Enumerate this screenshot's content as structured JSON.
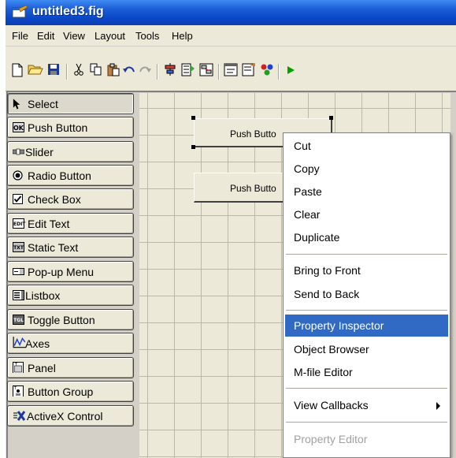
{
  "window": {
    "title": "untitled3.fig"
  },
  "menubar": {
    "items": [
      "File",
      "Edit",
      "View",
      "Layout",
      "Tools",
      "Help"
    ]
  },
  "toolbar": {
    "buttons": [
      "new-icon",
      "open-icon",
      "save-icon",
      "cut-icon",
      "copy-icon",
      "paste-icon",
      "undo-icon",
      "redo-icon",
      "align-icon",
      "menu-editor-icon",
      "tab-order-icon",
      "mfile-editor-icon",
      "property-inspector-icon",
      "object-browser-icon",
      "run-icon"
    ]
  },
  "palette": {
    "items": [
      {
        "label": "Select",
        "icon": "arrow-icon"
      },
      {
        "label": "Push Button",
        "icon": "ok-icon"
      },
      {
        "label": "Slider",
        "icon": "slider-icon"
      },
      {
        "label": "Radio Button",
        "icon": "radio-icon"
      },
      {
        "label": "Check Box",
        "icon": "checkbox-icon"
      },
      {
        "label": "Edit Text",
        "icon": "edit-text-icon",
        "icon_text": "EDIT"
      },
      {
        "label": "Static Text",
        "icon": "static-text-icon",
        "icon_text": "TXT"
      },
      {
        "label": "Pop-up Menu",
        "icon": "popup-menu-icon"
      },
      {
        "label": "Listbox",
        "icon": "listbox-icon"
      },
      {
        "label": "Toggle Button",
        "icon": "toggle-icon",
        "icon_text": "TGL"
      },
      {
        "label": "Axes",
        "icon": "axes-icon"
      },
      {
        "label": "Panel",
        "icon": "panel-icon"
      },
      {
        "label": "Button Group",
        "icon": "button-group-icon"
      },
      {
        "label": "ActiveX Control",
        "icon": "activex-icon"
      }
    ],
    "ok_icon_text": "OK"
  },
  "canvas": {
    "buttons": [
      {
        "label": "Push Butto"
      },
      {
        "label": "Push Butto"
      }
    ]
  },
  "context_menu": {
    "items": [
      {
        "label": "Cut"
      },
      {
        "label": "Copy"
      },
      {
        "label": "Paste"
      },
      {
        "label": "Clear"
      },
      {
        "label": "Duplicate"
      },
      {
        "label": "Bring to Front"
      },
      {
        "label": "Send to Back"
      },
      {
        "label": "Property Inspector",
        "highlighted": true
      },
      {
        "label": "Object Browser"
      },
      {
        "label": "M-file Editor"
      },
      {
        "label": "View Callbacks",
        "submenu": true
      },
      {
        "label": "Property Editor",
        "disabled": true
      }
    ]
  },
  "colors": {
    "title_bar": "#0a48c8",
    "highlight": "#316ac5",
    "face": "#ece9d8",
    "run": "#00a000"
  }
}
